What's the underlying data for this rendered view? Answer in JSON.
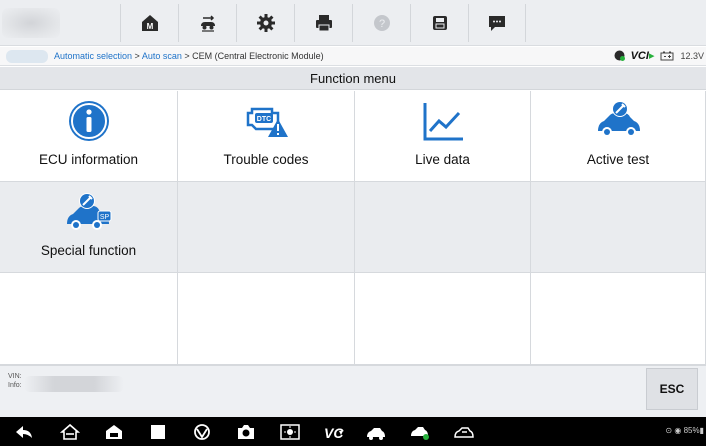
{
  "toolbar": {
    "buttons": [
      {
        "name": "home-icon",
        "letter": "M"
      },
      {
        "name": "vehicle-swap-icon"
      },
      {
        "name": "settings-icon"
      },
      {
        "name": "print-icon"
      },
      {
        "name": "help-icon"
      },
      {
        "name": "save-icon"
      },
      {
        "name": "messages-icon"
      }
    ]
  },
  "breadcrumb": {
    "link1": "Automatic selection",
    "sep1": " > ",
    "link2": "Auto scan",
    "sep2": " > ",
    "current": "CEM (Central Electronic Module)"
  },
  "status_area": {
    "vci_label": "VCI",
    "voltage": "12.3V"
  },
  "menu_title": "Function menu",
  "functions": [
    {
      "label": "ECU information",
      "icon": "info-icon"
    },
    {
      "label": "Trouble codes",
      "icon": "dtc-engine-icon",
      "icon_text": "DTC"
    },
    {
      "label": "Live data",
      "icon": "line-chart-icon"
    },
    {
      "label": "Active test",
      "icon": "car-wrench-icon"
    },
    {
      "label": "Special function",
      "icon": "car-special-icon",
      "icon_text": "SP"
    }
  ],
  "vehicle_info": {
    "vin_label": "VIN:",
    "info_label": "Info:"
  },
  "esc_label": "ESC",
  "system_status": "85%",
  "colors": {
    "accent": "#1f73c9",
    "toolbar": "#eceef1",
    "cell_shade": "#eaecef"
  }
}
